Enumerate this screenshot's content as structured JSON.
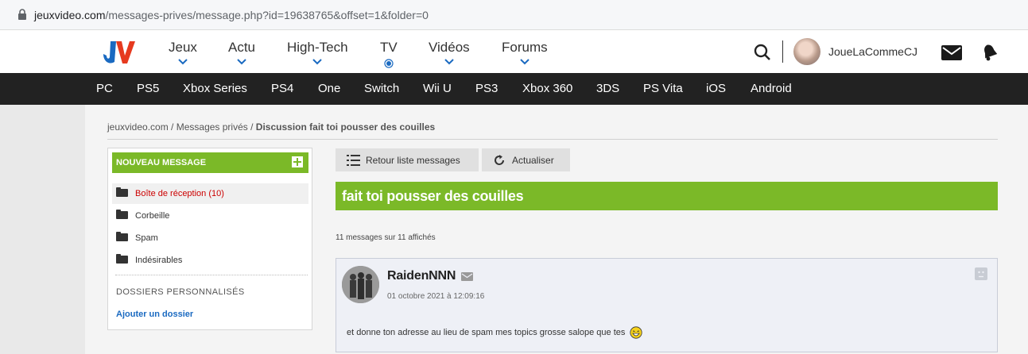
{
  "browser": {
    "url_host": "jeuxvideo.com",
    "url_path": "/messages-prives/message.php?id=19638765&offset=1&folder=0"
  },
  "header": {
    "logo_text": "JV",
    "nav": [
      {
        "label": "Jeux"
      },
      {
        "label": "Actu"
      },
      {
        "label": "High-Tech"
      },
      {
        "label": "TV"
      },
      {
        "label": "Vidéos"
      },
      {
        "label": "Forums"
      }
    ],
    "username": "JoueLaCommeCJ"
  },
  "platforms": [
    "PC",
    "PS5",
    "Xbox Series",
    "PS4",
    "One",
    "Switch",
    "Wii U",
    "PS3",
    "Xbox 360",
    "3DS",
    "PS Vita",
    "iOS",
    "Android"
  ],
  "breadcrumb": {
    "site": "jeuxvideo.com",
    "sep": " / ",
    "section": "Messages privés",
    "current": "Discussion fait toi pousser des couilles"
  },
  "sidebar": {
    "new_message": "NOUVEAU MESSAGE",
    "folders": [
      {
        "label": "Boîte de réception (10)"
      },
      {
        "label": "Corbeille"
      },
      {
        "label": "Spam"
      },
      {
        "label": "Indésirables"
      }
    ],
    "perso_title": "DOSSIERS PERSONNALISÉS",
    "add_folder": "Ajouter un dossier"
  },
  "toolbar": {
    "back_label": "Retour liste messages",
    "refresh_label": "Actualiser"
  },
  "topic": {
    "title": "fait toi pousser des couilles",
    "count": "11 messages sur 11 affichés"
  },
  "message": {
    "author": "RaidenNNN",
    "date": "01 octobre 2021 à 12:09:16",
    "text": "et donne ton adresse au lieu de spam mes topics grosse salope que tes"
  },
  "colors": {
    "green": "#7bb928",
    "dark_bar": "#222222",
    "link_blue": "#1a6ac1",
    "active_red": "#cc0000"
  }
}
